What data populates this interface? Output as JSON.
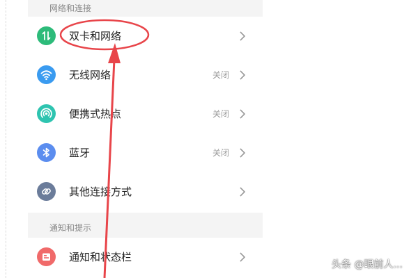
{
  "sections": {
    "network": {
      "header": "网络和连接"
    },
    "notify": {
      "header": "通知和提示"
    }
  },
  "rows": {
    "dual_sim": {
      "label": "双卡和网络",
      "icon": "dual-arrows-icon",
      "color": "#2dbb7a"
    },
    "wifi": {
      "label": "无线网络",
      "status": "关闭",
      "icon": "wifi-icon",
      "color": "#3a9bf0"
    },
    "hotspot": {
      "label": "便携式热点",
      "status": "关闭",
      "icon": "hotspot-icon",
      "color": "#2ec4b0"
    },
    "bluetooth": {
      "label": "蓝牙",
      "status": "关闭",
      "icon": "bluetooth-icon",
      "color": "#5b8def"
    },
    "other": {
      "label": "其他连接方式",
      "icon": "link-icon",
      "color": "#6b7c9a"
    },
    "notification": {
      "label": "通知和状态栏",
      "icon": "notification-icon",
      "color": "#f06a6a"
    }
  },
  "annotation": {
    "color": "#e8454a"
  },
  "watermark": {
    "text": "头条 @眼前人..."
  }
}
